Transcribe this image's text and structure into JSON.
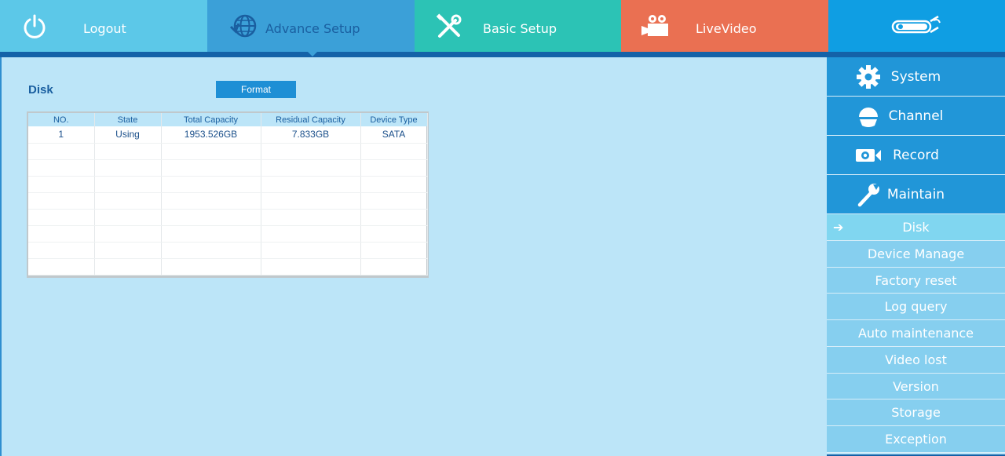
{
  "topnav": {
    "logout": "Logout",
    "advance_setup": "Advance Setup",
    "basic_setup": "Basic Setup",
    "live_video": "LiveVideo"
  },
  "disk": {
    "title": "Disk",
    "format_label": "Format",
    "columns": [
      "NO.",
      "State",
      "Total Capacity",
      "Residual Capacity",
      "Device Type"
    ],
    "rows": [
      [
        "1",
        "Using",
        "1953.526GB",
        "7.833GB",
        "SATA"
      ]
    ]
  },
  "sidebar": {
    "main": [
      {
        "label": "System",
        "icon": "gear-icon"
      },
      {
        "label": "Channel",
        "icon": "dome-camera-icon"
      },
      {
        "label": "Record",
        "icon": "record-camera-icon"
      },
      {
        "label": "Maintain",
        "icon": "wrench-icon"
      }
    ],
    "sub": [
      "Disk",
      "Device Manage",
      "Factory reset",
      "Log query",
      "Auto maintenance",
      "Video lost",
      "Version",
      "Storage",
      "Exception"
    ],
    "active_sub": "Disk"
  },
  "colors": {
    "logout": "#5cc8e8",
    "advance": "#3ba0d8",
    "basic": "#2cc3b5",
    "live": "#ea7052",
    "brand": "#0f9ee3",
    "background": "#bce5f8"
  }
}
